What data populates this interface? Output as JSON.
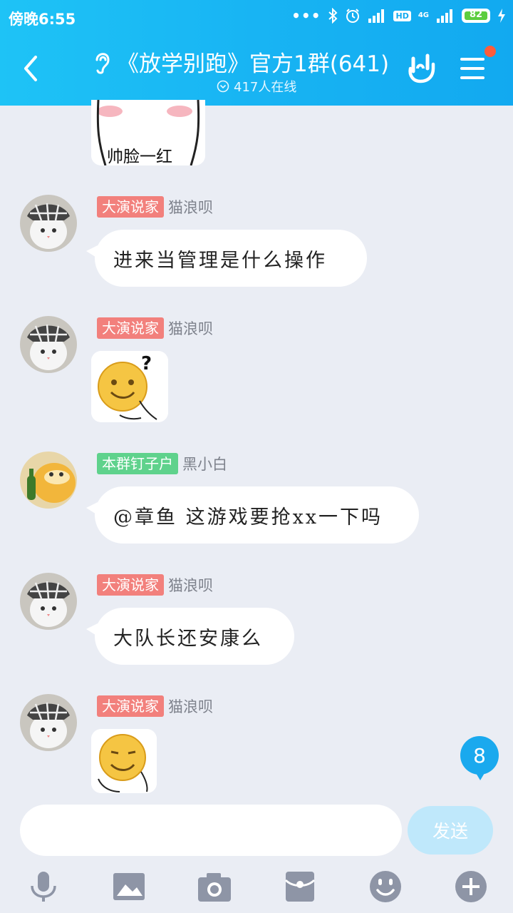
{
  "status_bar": {
    "time": "傍晚6:55",
    "network": "4G",
    "hd": "HD",
    "battery": "82"
  },
  "header": {
    "title": "《放学别跑》官方1群(641)",
    "online": "417人在线"
  },
  "messages": [
    {
      "tag": "大演说家",
      "nick": "猫浪呗",
      "text": "进来当管理是什么操作"
    },
    {
      "tag": "大演说家",
      "nick": "猫浪呗"
    },
    {
      "tag": "本群钉子户",
      "nick": "黑小白",
      "text": "@章鱼 这游戏要抢xx一下吗"
    },
    {
      "tag": "大演说家",
      "nick": "猫浪呗",
      "text": "大队长还安康么"
    },
    {
      "tag": "大演说家",
      "nick": "猫浪呗"
    }
  ],
  "sticker_top_caption": "帅脸一红",
  "unread_count": "8",
  "input": {
    "value": "",
    "placeholder": ""
  },
  "send_label": "发送",
  "colors": {
    "header": "#18b4f3",
    "tag_red": "#f2807c",
    "tag_green": "#5fd28c",
    "background": "#eaedf4"
  },
  "toolbar_icons": [
    "microphone-icon",
    "image-icon",
    "camera-icon",
    "red-packet-icon",
    "emoji-icon",
    "plus-icon"
  ]
}
